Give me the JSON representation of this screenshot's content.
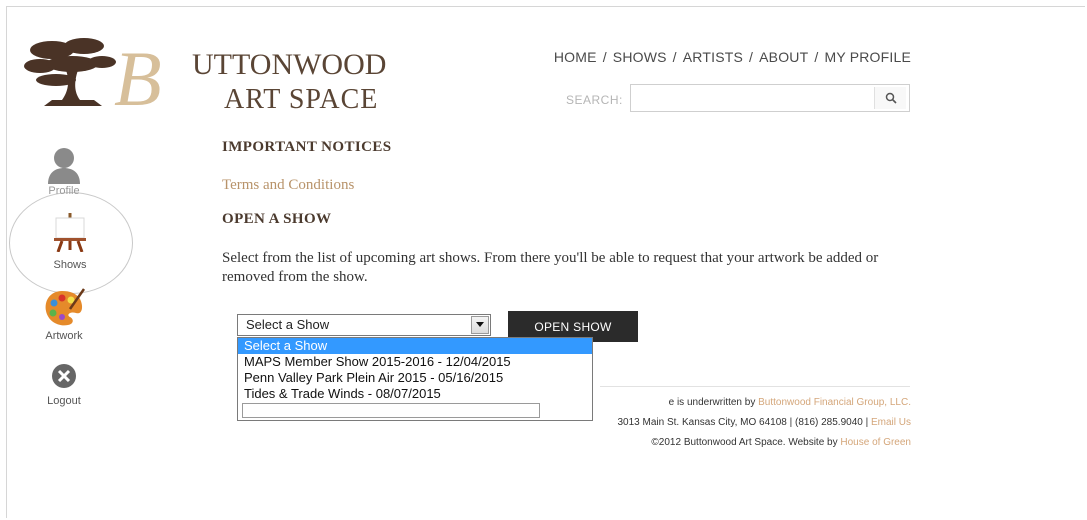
{
  "brand": {
    "line1": "UTTONWOOD",
    "line2": "ART SPACE",
    "initial": "B"
  },
  "nav": {
    "items": [
      "HOME",
      "SHOWS",
      "ARTISTS",
      "ABOUT",
      "MY PROFILE"
    ],
    "separator": "/"
  },
  "search": {
    "label": "SEARCH:",
    "value": "",
    "icon": "search-icon"
  },
  "sidebar": {
    "items": [
      {
        "label": "Profile",
        "icon": "profile-icon"
      },
      {
        "label": "Shows",
        "icon": "easel-icon"
      },
      {
        "label": "Artwork",
        "icon": "palette-icon"
      },
      {
        "label": "Logout",
        "icon": "close-circle-icon"
      }
    ],
    "active": "Shows"
  },
  "notices": {
    "heading": "IMPORTANT NOTICES",
    "terms_link": "Terms and Conditions"
  },
  "open_show": {
    "heading": "OPEN A SHOW",
    "description": "Select from the list of upcoming art shows. From there you'll be able to request that your artwork be added or removed from the show.",
    "select_value": "Select a Show",
    "options": [
      "Select a Show",
      "MAPS Member Show 2015-2016 - 12/04/2015",
      "Penn Valley Park Plein Air 2015 - 05/16/2015",
      "Tides & Trade Winds - 08/07/2015"
    ],
    "button_label": "OPEN SHOW"
  },
  "footer": {
    "line1_prefix": "e is underwritten by ",
    "line1_link": "Buttonwood Financial Group, LLC.",
    "line2_prefix": "3013 Main St. Kansas City, MO 64108 | (816) 285.9040 | ",
    "line2_link": "Email Us",
    "line3_prefix": "©2012 Buttonwood Art Space. Website by ",
    "line3_link": "House of Green"
  },
  "colors": {
    "brand_brown": "#5a4535",
    "brand_tan": "#d7bf9a",
    "link_gold": "#b8936a",
    "footer_link": "#d4a67a",
    "button_dark": "#2b2b2b",
    "dropdown_highlight": "#3399ff"
  }
}
